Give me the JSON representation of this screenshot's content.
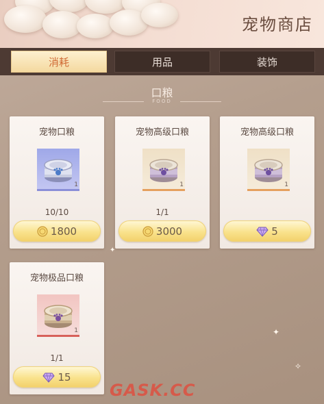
{
  "header": {
    "title": "宠物商店"
  },
  "tabs": [
    {
      "label": "消耗",
      "active": true
    },
    {
      "label": "用品",
      "active": false
    },
    {
      "label": "装饰",
      "active": false
    }
  ],
  "section": {
    "label": "口粮",
    "sub": "FOOD"
  },
  "items": [
    {
      "name": "宠物口粮",
      "qty": "1",
      "stock": "10/10",
      "price": "1800",
      "currency": "coin-icon",
      "rarity": "blue"
    },
    {
      "name": "宠物高级口粮",
      "qty": "1",
      "stock": "1/1",
      "price": "3000",
      "currency": "coin-icon",
      "rarity": "gold"
    },
    {
      "name": "宠物高级口粮",
      "qty": "1",
      "stock": "",
      "price": "5",
      "currency": "diamond-icon",
      "rarity": "gold"
    },
    {
      "name": "宠物极品口粮",
      "qty": "1",
      "stock": "1/1",
      "price": "15",
      "currency": "diamond-icon",
      "rarity": "red"
    }
  ],
  "watermark": "GASK.CC",
  "colors": {
    "active_tab": "#d06b35",
    "tabbar": "#4d3a33",
    "price_button": "#f9e28c",
    "watermark": "#e14b3c"
  }
}
